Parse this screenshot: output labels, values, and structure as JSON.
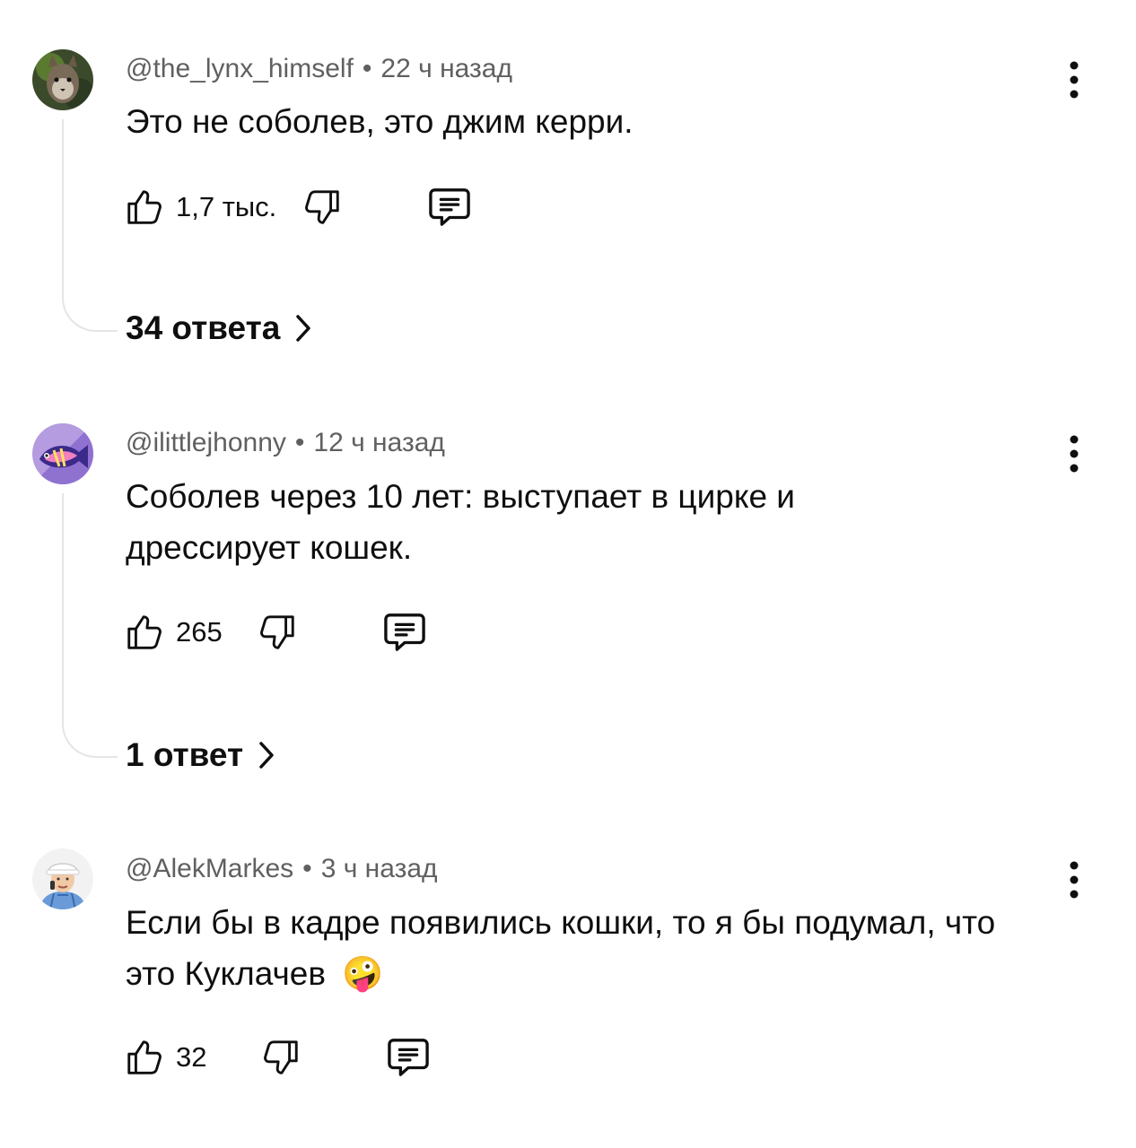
{
  "comments": [
    {
      "author": "@the_lynx_himself",
      "time": "22 ч назад",
      "text": "Это не соболев, это джим керри.",
      "likes": "1,7 тыс.",
      "replies": "34 ответа"
    },
    {
      "author": "@ilittlejhonny",
      "time": "12 ч назад",
      "text": "Соболев через 10 лет: выступает в цирке и дрессирует кошек.",
      "likes": "265",
      "replies": "1 ответ"
    },
    {
      "author": "@AlekMarkes",
      "time": "3 ч назад",
      "text": "Если бы в кадре появились кошки, то я бы подумал, что это Куклачев",
      "emoji": "🤪",
      "likes": "32"
    }
  ],
  "separator": "•",
  "icons": {
    "like": "thumbs-up-icon",
    "dislike": "thumbs-down-icon",
    "reply": "reply-comment-icon",
    "more": "more-vertical-icon",
    "chevron": "chevron-right-icon"
  }
}
